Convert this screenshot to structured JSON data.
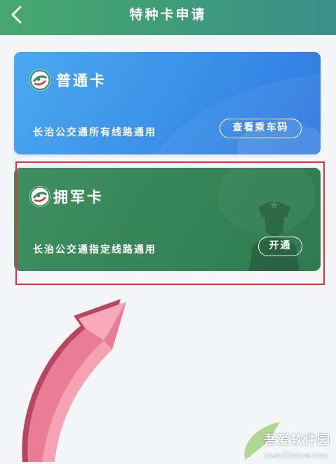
{
  "header": {
    "title": "特种卡申请",
    "back_icon": "chevron-left-icon",
    "color_start": "#46a86e",
    "color_end": "#3b8f8b"
  },
  "cards": [
    {
      "name": "普通卡",
      "description": "长治公交通所有线路通用",
      "action_label": "查看乘车码",
      "color": "#3b8fe8",
      "logo_icon": "bus-logo-icon",
      "decoration_icon": "cloud-icon"
    },
    {
      "name": "拥军卡",
      "description": "长治公交通指定线路通用",
      "action_label": "开通",
      "color": "#368456",
      "logo_icon": "bus-logo-icon",
      "decoration_icon": "soldier-icon"
    }
  ],
  "annotation": {
    "highlight_color": "#e2343f",
    "arrow_color": "#e86d8a",
    "arrow_icon": "curved-arrow-icon"
  },
  "watermark": {
    "brand": "吾爱软件园",
    "url": "www.52zixue.com"
  }
}
